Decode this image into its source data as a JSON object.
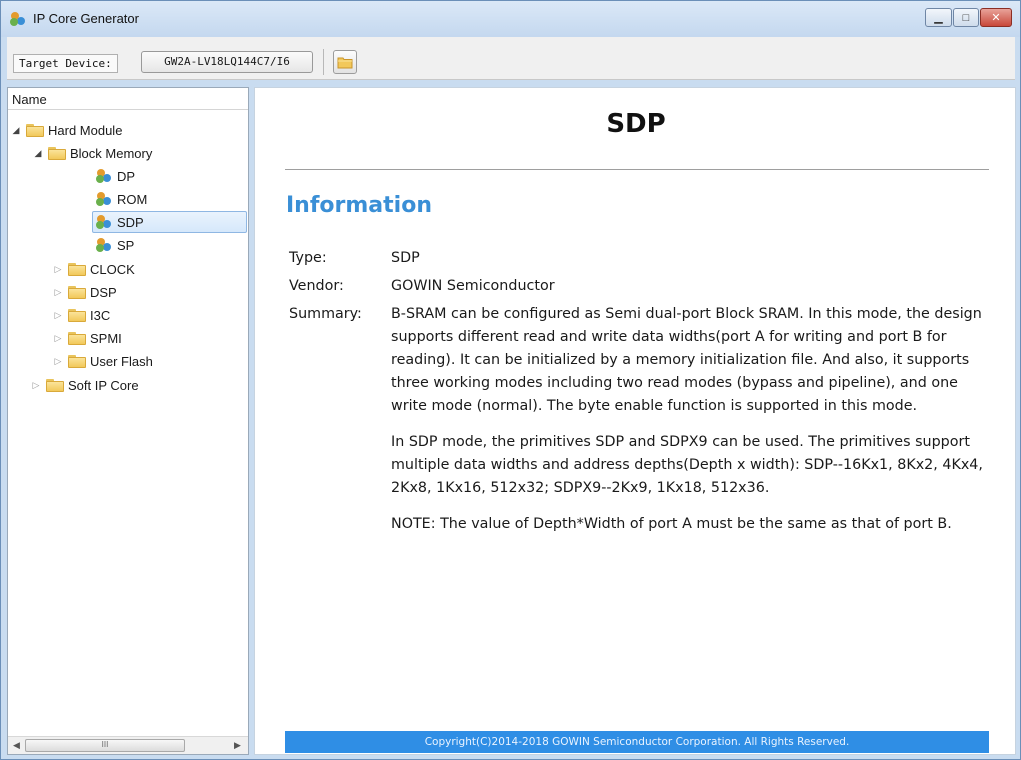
{
  "window": {
    "title": "IP Core Generator",
    "icon": "ip-core-icon",
    "controls": [
      "minimize-icon",
      "maximize-icon",
      "close-icon"
    ]
  },
  "toolbar": {
    "target_label": "Target Device:",
    "device": "GW2A-LV18LQ144C7/I6",
    "open_icon": "folder-open-icon"
  },
  "tree": {
    "header": "Name",
    "items": [
      {
        "label": "Hard Module",
        "expanded": true
      },
      {
        "label": "Block Memory",
        "expanded": true
      },
      {
        "label": "DP"
      },
      {
        "label": "ROM"
      },
      {
        "label": "SDP",
        "selected": true
      },
      {
        "label": "SP"
      },
      {
        "label": "CLOCK",
        "expanded": false
      },
      {
        "label": "DSP",
        "expanded": false
      },
      {
        "label": "I3C",
        "expanded": false
      },
      {
        "label": "SPMI",
        "expanded": false
      },
      {
        "label": "User Flash",
        "expanded": false
      },
      {
        "label": "Soft IP Core",
        "expanded": false
      }
    ],
    "scroll_thumb": "III"
  },
  "doc": {
    "title": "SDP",
    "section": "Information",
    "type_key": "Type:",
    "type_val": "SDP",
    "vendor_key": "Vendor:",
    "vendor_val": "GOWIN Semiconductor",
    "summary_key": "Summary:",
    "summary_p1": "B-SRAM can be configured as Semi dual-port Block SRAM. In this mode, the design supports different read and write data widths(port A for writing and port B for reading). It can be initialized by a memory initialization file. And also, it supports three working modes including two read modes (bypass and pipeline), and one write mode (normal). The byte enable function is supported in this mode.",
    "summary_p2": "In SDP mode, the primitives SDP and SDPX9 can be used. The primitives support multiple data widths and address depths(Depth x width): SDP--16Kx1, 8Kx2, 4Kx4, 2Kx8, 1Kx16, 512x32; SDPX9--2Kx9, 1Kx18, 512x36.",
    "summary_p3": "NOTE: The value of Depth*Width of port A must be the same as that of port B.",
    "footer": "Copyright(C)2014-2018 GOWIN Semiconductor Corporation. All Rights Reserved."
  },
  "colors": {
    "accent_heading": "#3a8fd6",
    "footer_bar": "#2f8ee5",
    "selection": "#d6e8fb"
  }
}
